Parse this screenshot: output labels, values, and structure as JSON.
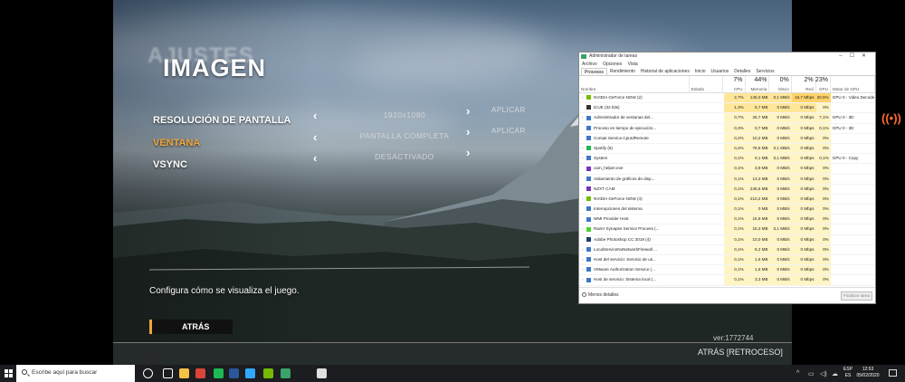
{
  "game": {
    "title": "IMAGEN",
    "title_ghost": "AJUSTES",
    "settings": [
      {
        "label": "RESOLUCIÓN DE PANTALLA",
        "value": "1920x1080",
        "apply": "APLICAR",
        "active": false
      },
      {
        "label": "VENTANA",
        "value": "PANTALLA COMPLETA",
        "apply": "APLICAR",
        "active": true
      },
      {
        "label": "VSYNC",
        "value": "DESACTIVADO",
        "apply": "",
        "active": false
      }
    ],
    "description": "Configura cómo se visualiza el juego.",
    "back_button": "ATRÁS",
    "version": "ver:1772744",
    "back_hint": "ATRÁS  [RETROCESO]",
    "accent_color": "#f0a43a"
  },
  "broadcast_icon": "broadcast-icon",
  "task_manager": {
    "title": "Administrador de tareas",
    "window_buttons": [
      "–",
      "☐",
      "✕"
    ],
    "menu": [
      "Archivo",
      "Opciones",
      "Vista"
    ],
    "tabs": [
      "Procesos",
      "Rendimiento",
      "Historial de aplicaciones",
      "Inicio",
      "Usuarios",
      "Detalles",
      "Servicios"
    ],
    "active_tab": "Procesos",
    "columns": {
      "name": "Nombre",
      "status": "Estado",
      "cpu": {
        "label": "CPU",
        "pct": "7%"
      },
      "mem": {
        "label": "Memoria",
        "pct": "44%"
      },
      "disk": {
        "label": "Disco",
        "pct": "0%"
      },
      "net": {
        "label": "Red",
        "pct": "2%"
      },
      "gpu": {
        "label": "GPU",
        "pct": "23%"
      },
      "engine": {
        "label": "Motor de GPU"
      }
    },
    "rows": [
      {
        "exp": "›",
        "name": "NVIDIA GeForce NOW (2)",
        "cpu": "2,7%",
        "mem": "145,0 MB",
        "disk": "0,1 MB/s",
        "net": "16,7 Mbps",
        "gpu": "20,5%",
        "engine": "GPU 0 - Video Decode",
        "icon_color": "#76b900"
      },
      {
        "exp": "",
        "name": "iCUE (32 bits)",
        "cpu": "1,3%",
        "mem": "6,7 MB",
        "disk": "0 MB/s",
        "net": "0 Mbps",
        "gpu": "0%",
        "engine": "",
        "icon_color": "#333"
      },
      {
        "exp": "›",
        "name": "Administrador de ventanas del...",
        "cpu": "0,7%",
        "mem": "25,7 MB",
        "disk": "0 MB/s",
        "net": "0 Mbps",
        "gpu": "7,1%",
        "engine": "GPU 0 - 3D",
        "icon_color": "#3a78c9"
      },
      {
        "exp": "",
        "name": "Proceso en tiempo de ejecución...",
        "cpu": "0,3%",
        "mem": "0,7 MB",
        "disk": "0 MB/s",
        "net": "0 Mbps",
        "gpu": "0,1%",
        "engine": "GPU 0 - 3D",
        "icon_color": "#3a78c9"
      },
      {
        "exp": "",
        "name": "Corsair.Service.CpuIdRemote",
        "cpu": "0,2%",
        "mem": "10,2 MB",
        "disk": "0 MB/s",
        "net": "0 Mbps",
        "gpu": "0%",
        "engine": "",
        "icon_color": "#3a78c9"
      },
      {
        "exp": "›",
        "name": "Spotify (5)",
        "cpu": "0,2%",
        "mem": "78,6 MB",
        "disk": "0,1 MB/s",
        "net": "0 Mbps",
        "gpu": "0%",
        "engine": "",
        "icon_color": "#1db954"
      },
      {
        "exp": "›",
        "name": "System",
        "cpu": "0,1%",
        "mem": "0,1 MB",
        "disk": "0,1 MB/s",
        "net": "0 Mbps",
        "gpu": "0,1%",
        "engine": "GPU 0 - Copy",
        "icon_color": "#3a78c9"
      },
      {
        "exp": "",
        "name": "cam_helper.exe",
        "cpu": "0,1%",
        "mem": "3,9 MB",
        "disk": "0 MB/s",
        "net": "0 Mbps",
        "gpu": "0%",
        "engine": "",
        "icon_color": "#7b2fbf"
      },
      {
        "exp": "",
        "name": "Aislamiento de gráficos de disp...",
        "cpu": "0,1%",
        "mem": "13,3 MB",
        "disk": "0 MB/s",
        "net": "0 Mbps",
        "gpu": "0%",
        "engine": "",
        "icon_color": "#3a78c9"
      },
      {
        "exp": "",
        "name": "NZXT CAM",
        "cpu": "0,1%",
        "mem": "246,5 MB",
        "disk": "0 MB/s",
        "net": "0 Mbps",
        "gpu": "0%",
        "engine": "",
        "icon_color": "#7b2fbf"
      },
      {
        "exp": "›",
        "name": "NVIDIA GeForce NOW (4)",
        "cpu": "0,1%",
        "mem": "210,2 MB",
        "disk": "0 MB/s",
        "net": "0 Mbps",
        "gpu": "0%",
        "engine": "",
        "icon_color": "#76b900"
      },
      {
        "exp": "",
        "name": "Interrupciones del sistema",
        "cpu": "0,1%",
        "mem": "0 MB",
        "disk": "0 MB/s",
        "net": "0 Mbps",
        "gpu": "0%",
        "engine": "",
        "icon_color": "#3a78c9"
      },
      {
        "exp": "",
        "name": "WMI Provider Host",
        "cpu": "0,1%",
        "mem": "15,9 MB",
        "disk": "0 MB/s",
        "net": "0 Mbps",
        "gpu": "0%",
        "engine": "",
        "icon_color": "#3a78c9"
      },
      {
        "exp": "›",
        "name": "Razer Synapse Service Process (...",
        "cpu": "0,1%",
        "mem": "16,3 MB",
        "disk": "0,1 MB/s",
        "net": "0 Mbps",
        "gpu": "0%",
        "engine": "",
        "icon_color": "#44d62c"
      },
      {
        "exp": "",
        "name": "Adobe Photoshop CC 2019 (4)",
        "cpu": "0,1%",
        "mem": "10,0 MB",
        "disk": "0 MB/s",
        "net": "0 Mbps",
        "gpu": "0%",
        "engine": "",
        "icon_color": "#1c3c6e"
      },
      {
        "exp": "›",
        "name": "LocalServiceNoNetworkFirewall ...",
        "cpu": "0,1%",
        "mem": "8,2 MB",
        "disk": "0 MB/s",
        "net": "0 Mbps",
        "gpu": "0%",
        "engine": "",
        "icon_color": "#3a78c9"
      },
      {
        "exp": "›",
        "name": "Host del servicio: Servicio de us...",
        "cpu": "0,1%",
        "mem": "1,6 MB",
        "disk": "0 MB/s",
        "net": "0 Mbps",
        "gpu": "0%",
        "engine": "",
        "icon_color": "#3a78c9"
      },
      {
        "exp": "›",
        "name": "VMware Authorization Service (...",
        "cpu": "0,1%",
        "mem": "1,6 MB",
        "disk": "0 MB/s",
        "net": "0 Mbps",
        "gpu": "0%",
        "engine": "",
        "icon_color": "#3a78c9"
      },
      {
        "exp": "›",
        "name": "Host de servicio: Sistema local (...",
        "cpu": "0,1%",
        "mem": "3,3 MB",
        "disk": "0 MB/s",
        "net": "0 Mbps",
        "gpu": "0%",
        "engine": "",
        "icon_color": "#3a78c9"
      }
    ],
    "less_details": "Menos detalles",
    "end_task": "Finalizar tarea"
  },
  "taskbar": {
    "search_placeholder": "Escribe aquí para buscar",
    "apps": [
      {
        "name": "cortana-icon",
        "color": "#ffffff"
      },
      {
        "name": "task-view-icon",
        "color": "#ffffff"
      },
      {
        "name": "file-explorer-icon",
        "color": "#f6c244"
      },
      {
        "name": "chrome-icon",
        "color": "#db4437"
      },
      {
        "name": "spotify-icon",
        "color": "#1db954"
      },
      {
        "name": "word-icon",
        "color": "#2b579a"
      },
      {
        "name": "photoshop-icon",
        "color": "#31a8ff"
      },
      {
        "name": "geforce-now-icon",
        "color": "#76b900"
      },
      {
        "name": "task-manager-icon",
        "color": "#3aa36a"
      },
      {
        "name": "snipping-icon",
        "color": "#e0e0e0"
      }
    ],
    "lang": "ESP",
    "lang_sub": "ES",
    "time": "12:53",
    "date": "05/02/2020"
  }
}
